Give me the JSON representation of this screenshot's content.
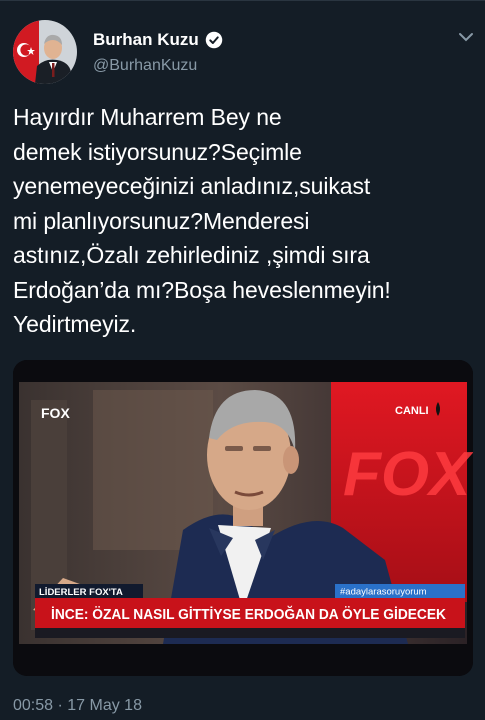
{
  "tweet": {
    "author_name": "Burhan Kuzu",
    "author_handle": "@BurhanKuzu",
    "verified": true,
    "text": "Hayırdır Muharrem Bey ne\ndemek istiyorsunuz?Seçimle\nyenemeyeceğinizi anladınız,suikast\nmi planlıyorsunuz?Menderesi\nastınız,Özalı zehirlediniz ,şimdi sıra\nErdoğan’da mı?Boşa heveslenmeyin!\nYedirtmeyiz.",
    "timestamp": "00:58 · 17 May 18"
  },
  "media": {
    "channel_logo": "FOX",
    "live_label": "CANLI",
    "background_logo": "FOX",
    "program_label": "LİDERLER FOX'TA",
    "hashtag": "#adaylarasoruyorum",
    "headline": "İNCE: ÖZAL NASIL GİTTİYSE ERDOĞAN DA ÖYLE GİDECEK"
  },
  "icons": {
    "verified": "verified-badge-icon",
    "menu": "chevron-down-icon"
  },
  "colors": {
    "background": "#141d26",
    "secondary_text": "#8899a6",
    "fox_red": "#d8121c"
  }
}
